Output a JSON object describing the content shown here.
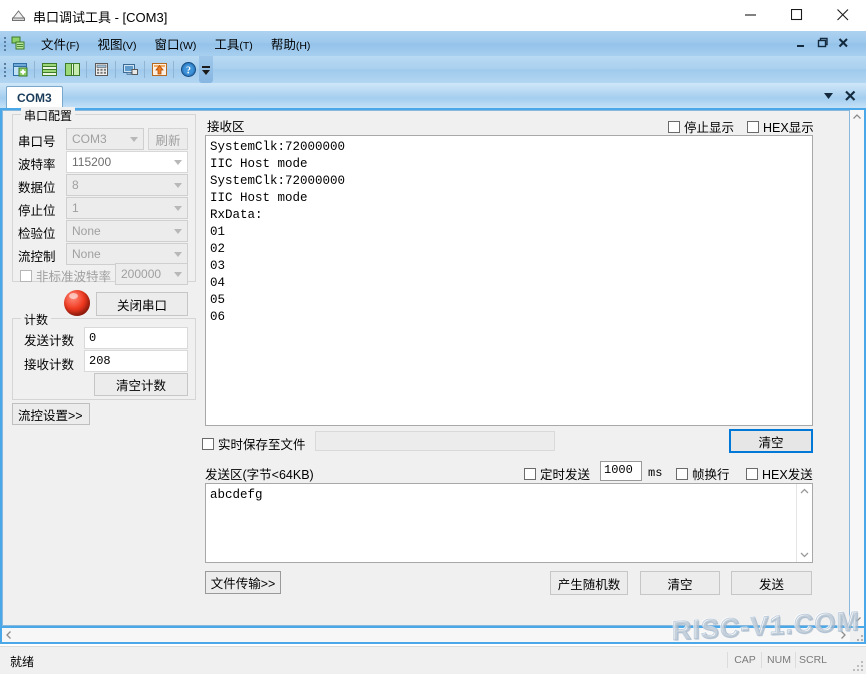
{
  "window": {
    "title": "串口调试工具 - [COM3]",
    "icon": "serial-tool-icon",
    "minimize": "minimize-icon",
    "maximize": "maximize-icon",
    "close": "close-icon"
  },
  "menu": {
    "icon": "mdi-windows-icon",
    "items": [
      {
        "label": "文件",
        "accel": "(F)"
      },
      {
        "label": "视图",
        "accel": "(V)"
      },
      {
        "label": "窗口",
        "accel": "(W)"
      },
      {
        "label": "工具",
        "accel": "(T)"
      },
      {
        "label": "帮助",
        "accel": "(H)"
      }
    ],
    "mdi_minimize": "mdi-minimize-icon",
    "mdi_restore": "mdi-restore-icon",
    "mdi_close": "mdi-close-icon"
  },
  "toolbar": {
    "buttons": [
      "new-window-icon",
      "tile-horizontal-icon",
      "tile-vertical-icon",
      "calculator-icon",
      "terminal-icon",
      "upload-icon",
      "help-icon"
    ],
    "overflow": "toolbar-overflow-icon"
  },
  "tabs": {
    "items": [
      {
        "label": "COM3",
        "active": true
      }
    ],
    "dropdown": "tab-list-icon",
    "close": "tab-close-icon"
  },
  "config": {
    "title": "串口配置",
    "port_label": "串口号",
    "port_value": "COM3",
    "refresh_label": "刷新",
    "baud_label": "波特率",
    "baud_value": "115200",
    "databits_label": "数据位",
    "databits_value": "8",
    "stopbits_label": "停止位",
    "stopbits_value": "1",
    "parity_label": "检验位",
    "parity_value": "None",
    "flow_label": "流控制",
    "flow_value": "None",
    "custom_baud_label": "非标准波特率",
    "custom_baud_value": "200000",
    "custom_baud_checked": false,
    "open_close_label": "关闭串口",
    "led": "port-status-led"
  },
  "counter": {
    "title": "计数",
    "tx_label": "发送计数",
    "tx_value": "0",
    "rx_label": "接收计数",
    "rx_value": "208",
    "clear_label": "清空计数"
  },
  "flow_settings": {
    "label": "流控设置>>"
  },
  "receive": {
    "title": "接收区",
    "stop_display_label": "停止显示",
    "stop_display_checked": false,
    "hex_display_label": "HEX显示",
    "hex_display_checked": false,
    "content": "SystemClk:72000000\nIIC Host mode\nSystemClk:72000000\nIIC Host mode\nRxData:\n01\n02\n03\n04\n05\n06",
    "save_file_label": "实时保存至文件",
    "save_file_checked": false,
    "save_file_path": "",
    "clear_label": "清空"
  },
  "send": {
    "title": "发送区(字节<64KB)",
    "timed_send_label": "定时发送",
    "timed_send_checked": false,
    "interval_value": "1000",
    "interval_unit": "ms",
    "frame_newline_label": "帧换行",
    "frame_newline_checked": false,
    "hex_send_label": "HEX发送",
    "hex_send_checked": false,
    "content": "abcdefg",
    "file_transfer_label": "文件传输>>",
    "random_label": "产生随机数",
    "clear_label": "清空",
    "send_label": "发送"
  },
  "watermark": {
    "text": "RISC-V1.COM"
  },
  "status": {
    "text": "就绪",
    "indicators": [
      "CAP",
      "NUM",
      "SCRL"
    ]
  },
  "colors": {
    "accent": "#0078d7",
    "titlebar_blue": "#4aa8e8",
    "menubar": "#9cc8ec",
    "led_red": "#f03a20"
  }
}
